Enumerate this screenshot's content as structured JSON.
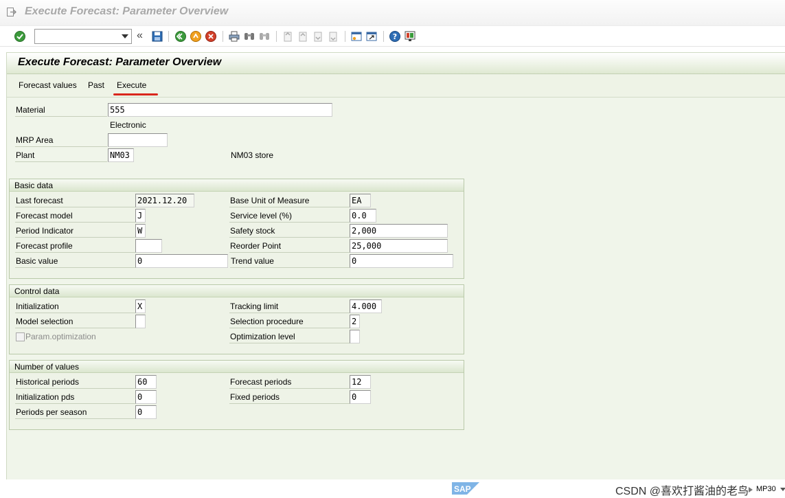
{
  "window": {
    "title": "Execute Forecast: Parameter Overview"
  },
  "toolbar": {
    "command_value": ""
  },
  "screen": {
    "title": "Execute Forecast: Parameter Overview",
    "app_buttons": [
      "Forecast values",
      "Past",
      "Execute"
    ]
  },
  "header": {
    "material_label": "Material",
    "material_value": "555",
    "material_desc": "Electronic",
    "mrp_area_label": "MRP Area",
    "mrp_area_value": "",
    "plant_label": "Plant",
    "plant_value": "NM03",
    "plant_desc": "NM03 store"
  },
  "basic_data": {
    "title": "Basic data",
    "last_forecast_label": "Last forecast",
    "last_forecast_value": "2021.12.20",
    "forecast_model_label": "Forecast model",
    "forecast_model_value": "J",
    "period_indicator_label": "Period Indicator",
    "period_indicator_value": "W",
    "forecast_profile_label": "Forecast profile",
    "forecast_profile_value": "",
    "basic_value_label": "Basic value",
    "basic_value_value": "0",
    "base_uom_label": "Base Unit of Measure",
    "base_uom_value": "EA",
    "service_level_label": "Service level (%)",
    "service_level_value": "0.0",
    "safety_stock_label": "Safety stock",
    "safety_stock_value": "2,000",
    "reorder_point_label": "Reorder Point",
    "reorder_point_value": "25,000",
    "trend_value_label": "Trend value",
    "trend_value_value": "0"
  },
  "control_data": {
    "title": "Control data",
    "initialization_label": "Initialization",
    "initialization_value": "X",
    "model_selection_label": "Model selection",
    "model_selection_value": "",
    "param_optimization_label": "Param.optimization",
    "tracking_limit_label": "Tracking limit",
    "tracking_limit_value": "4.000",
    "selection_procedure_label": "Selection procedure",
    "selection_procedure_value": "2",
    "optimization_level_label": "Optimization level",
    "optimization_level_value": ""
  },
  "number_of_values": {
    "title": "Number of values",
    "historical_periods_label": "Historical periods",
    "historical_periods_value": "60",
    "initialization_pds_label": "Initialization pds",
    "initialization_pds_value": "0",
    "periods_per_season_label": "Periods per season",
    "periods_per_season_value": "0",
    "forecast_periods_label": "Forecast periods",
    "forecast_periods_value": "12",
    "fixed_periods_label": "Fixed periods",
    "fixed_periods_value": "0"
  },
  "status": {
    "logo_text": "SAP",
    "tcode": "MP30",
    "watermark": "CSDN @喜欢打酱油的老鸟"
  },
  "colors": {
    "accent": "#d9261c",
    "work_bg": "#f0f5ea",
    "group_border": "#b9c9a9"
  }
}
